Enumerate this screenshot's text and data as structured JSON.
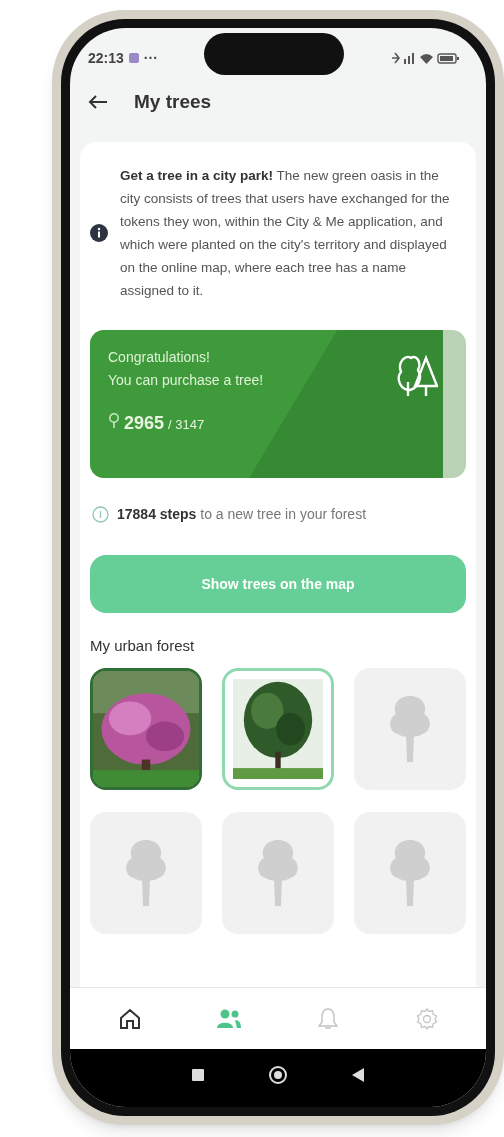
{
  "status_bar": {
    "time": "22:13",
    "notifications": "···"
  },
  "header": {
    "title": "My trees"
  },
  "info": {
    "text": "**Get a tree in a city park!** The new green oasis in the city consists of trees that users have exchanged for the tokens they won, within the City & Me application, and which were planted on the city's territory and displayed on the online map, where each tree has a name assigned to it."
  },
  "reward_card": {
    "line_1": "Congratulations!",
    "line_2": "You can purchase a tree!",
    "tokens": "2965",
    "target": "/ 3147",
    "level": 0.94
  },
  "steps_note": "**17884 steps** to a new tree in your forest",
  "map_button": "Show trees on the map",
  "forest": {
    "title": "My urban forest",
    "items": [
      {
        "kind": "picture",
        "selected": false
      },
      {
        "kind": "picture",
        "selected": true
      },
      {
        "kind": "empty"
      },
      {
        "kind": "empty"
      },
      {
        "kind": "empty"
      },
      {
        "kind": "empty"
      }
    ]
  },
  "bottom_nav": [
    {
      "selected": false
    },
    {
      "selected": true
    },
    {
      "selected": false
    },
    {
      "selected": false
    }
  ]
}
